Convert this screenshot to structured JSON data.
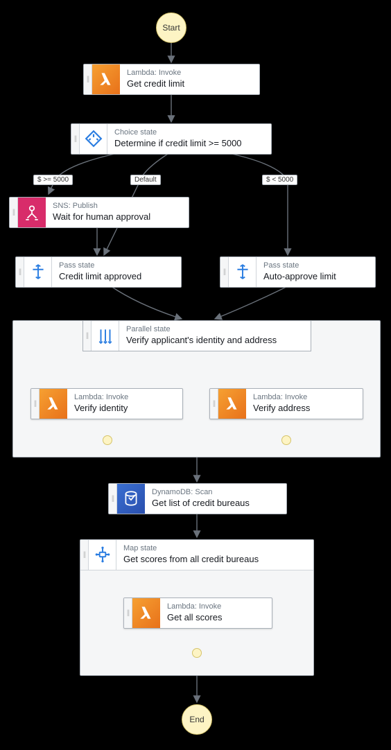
{
  "start": "Start",
  "end": "End",
  "svc": {
    "lambda": "Lambda: Invoke",
    "choice": "Choice state",
    "sns": "SNS: Publish",
    "pass": "Pass state",
    "parallel": "Parallel state",
    "dynamo": "DynamoDB: Scan",
    "map": "Map state"
  },
  "steps": {
    "get_credit_limit": "Get credit limit",
    "determine": "Determine if credit limit >= 5000",
    "wait_human": "Wait for human approval",
    "credit_approved": "Credit limit approved",
    "auto_approve": "Auto-approve limit",
    "verify_parallel": "Verify applicant's identity and address",
    "verify_identity": "Verify identity",
    "verify_address": "Verify address",
    "get_bureaus": "Get list of credit bureaus",
    "get_scores_map": "Get scores from all credit bureaus",
    "get_all_scores": "Get all scores"
  },
  "edges": {
    "ge5000": "$ >= 5000",
    "default": "Default",
    "lt5000": "$ < 5000"
  },
  "colors": {
    "lambda": "#e8711a",
    "sns": "#d82c6a",
    "dynamo": "#2a4fae",
    "blue": "#2a7de1"
  },
  "chart_data": {
    "type": "table",
    "description": "AWS Step Functions workflow graph — adjacency list",
    "nodes": [
      {
        "id": "start",
        "kind": "terminal",
        "label": "Start"
      },
      {
        "id": "get_credit_limit",
        "kind": "Lambda:Invoke",
        "label": "Get credit limit"
      },
      {
        "id": "determine",
        "kind": "Choice",
        "label": "Determine if credit limit >= 5000"
      },
      {
        "id": "wait_human",
        "kind": "SNS:Publish",
        "label": "Wait for human approval"
      },
      {
        "id": "credit_approved",
        "kind": "Pass",
        "label": "Credit limit approved"
      },
      {
        "id": "auto_approve",
        "kind": "Pass",
        "label": "Auto-approve limit"
      },
      {
        "id": "verify_parallel",
        "kind": "Parallel",
        "label": "Verify applicant's identity and address",
        "children": [
          "verify_identity",
          "verify_address"
        ]
      },
      {
        "id": "verify_identity",
        "kind": "Lambda:Invoke",
        "label": "Verify identity"
      },
      {
        "id": "verify_address",
        "kind": "Lambda:Invoke",
        "label": "Verify address"
      },
      {
        "id": "get_bureaus",
        "kind": "DynamoDB:Scan",
        "label": "Get list of credit bureaus"
      },
      {
        "id": "get_scores_map",
        "kind": "Map",
        "label": "Get scores from all credit bureaus",
        "children": [
          "get_all_scores"
        ]
      },
      {
        "id": "get_all_scores",
        "kind": "Lambda:Invoke",
        "label": "Get all scores"
      },
      {
        "id": "end",
        "kind": "terminal",
        "label": "End"
      }
    ],
    "edges": [
      {
        "from": "start",
        "to": "get_credit_limit"
      },
      {
        "from": "get_credit_limit",
        "to": "determine"
      },
      {
        "from": "determine",
        "to": "wait_human",
        "label": "$ >= 5000"
      },
      {
        "from": "determine",
        "to": "auto_approve",
        "label": "$ < 5000"
      },
      {
        "from": "determine",
        "to": "credit_approved",
        "label": "Default"
      },
      {
        "from": "wait_human",
        "to": "credit_approved"
      },
      {
        "from": "credit_approved",
        "to": "verify_parallel"
      },
      {
        "from": "auto_approve",
        "to": "verify_parallel"
      },
      {
        "from": "verify_parallel",
        "to": "get_bureaus"
      },
      {
        "from": "get_bureaus",
        "to": "get_scores_map"
      },
      {
        "from": "get_scores_map",
        "to": "end"
      }
    ]
  }
}
